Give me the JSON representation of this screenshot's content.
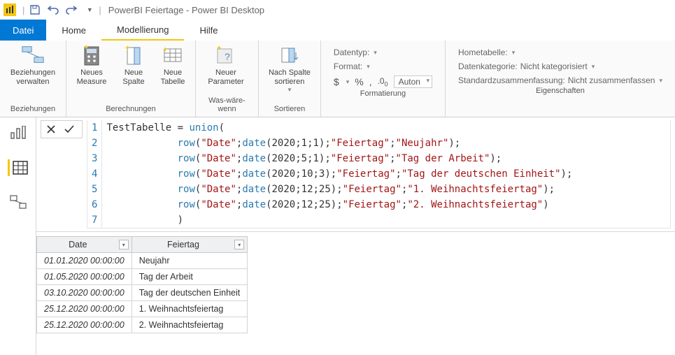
{
  "window": {
    "title": "PowerBI Feiertage - Power BI Desktop"
  },
  "tabs": {
    "file": "Datei",
    "home": "Home",
    "modeling": "Modellierung",
    "help": "Hilfe"
  },
  "ribbon": {
    "beziehungen": {
      "btn": "Beziehungen\nverwalten",
      "group": "Beziehungen"
    },
    "berechnungen": {
      "neues_measure": "Neues\nMeasure",
      "neue_spalte": "Neue\nSpalte",
      "neue_tabelle": "Neue\nTabelle",
      "group": "Berechnungen"
    },
    "waswaerewenn": {
      "neuer_parameter": "Neuer\nParameter",
      "group": "Was-wäre-wenn"
    },
    "sortieren": {
      "nach_spalte": "Nach Spalte\nsortieren",
      "group": "Sortieren"
    },
    "formatierung": {
      "datentyp": "Datentyp:",
      "format": "Format:",
      "dollar": "$",
      "percent": "%",
      "comma": ",",
      "decimals": ".00",
      "auto": "Auton",
      "group": "Formatierung"
    },
    "eigenschaften": {
      "hometabelle": "Hometabelle:",
      "datenkategorie_label": "Datenkategorie:",
      "datenkategorie_value": "Nicht kategorisiert",
      "standardzusammenfassung_label": "Standardzusammenfassung:",
      "standardzusammenfassung_value": "Nicht zusammenfassen",
      "group": "Eigenschaften"
    }
  },
  "formula": {
    "lines": [
      {
        "n": "1",
        "pre": "",
        "code": "TestTabelle = union("
      },
      {
        "n": "2",
        "pre": "            ",
        "code": "row(\"Date\";date(2020;1;1);\"Feiertag\";\"Neujahr\");"
      },
      {
        "n": "3",
        "pre": "            ",
        "code": "row(\"Date\";date(2020;5;1);\"Feiertag\";\"Tag der Arbeit\");"
      },
      {
        "n": "4",
        "pre": "            ",
        "code": "row(\"Date\";date(2020;10;3);\"Feiertag\";\"Tag der deutschen Einheit\");"
      },
      {
        "n": "5",
        "pre": "            ",
        "code": "row(\"Date\";date(2020;12;25);\"Feiertag\";\"1. Weihnachtsfeiertag\");"
      },
      {
        "n": "6",
        "pre": "            ",
        "code": "row(\"Date\";date(2020;12;25);\"Feiertag\";\"2. Weihnachtsfeiertag\")"
      },
      {
        "n": "7",
        "pre": "            ",
        "code": ")"
      }
    ]
  },
  "table": {
    "headers": {
      "date": "Date",
      "feiertag": "Feiertag"
    },
    "rows": [
      {
        "date": "01.01.2020 00:00:00",
        "feiertag": "Neujahr"
      },
      {
        "date": "01.05.2020 00:00:00",
        "feiertag": "Tag der Arbeit"
      },
      {
        "date": "03.10.2020 00:00:00",
        "feiertag": "Tag der deutschen Einheit"
      },
      {
        "date": "25.12.2020 00:00:00",
        "feiertag": "1. Weihnachtsfeiertag"
      },
      {
        "date": "25.12.2020 00:00:00",
        "feiertag": "2. Weihnachtsfeiertag"
      }
    ]
  }
}
